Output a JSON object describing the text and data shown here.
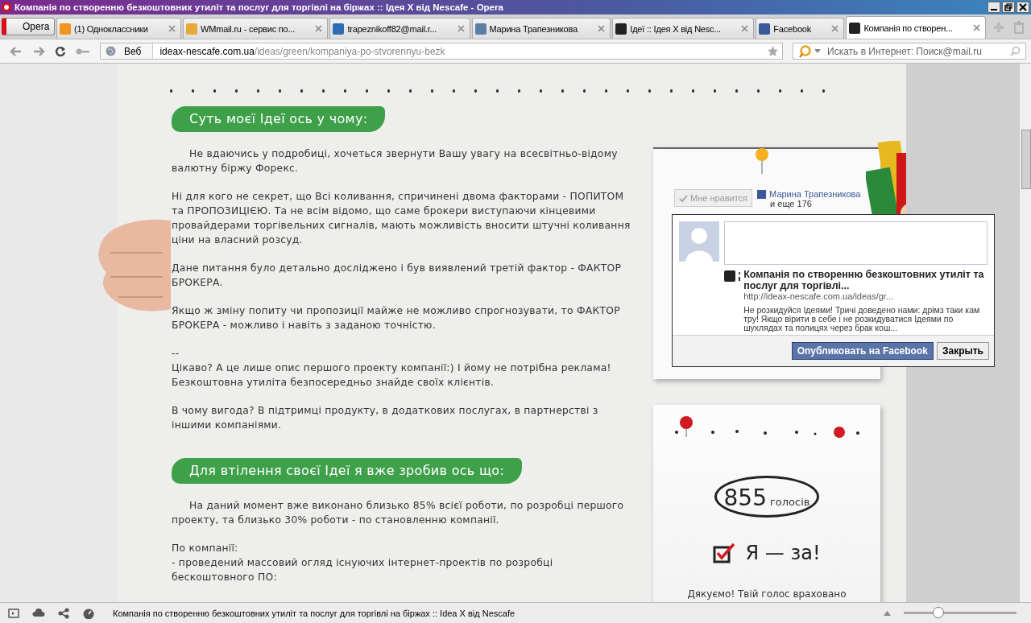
{
  "window": {
    "title": "Компанія по створенню безкоштовних утиліт та послуг для торгівлі на біржах :: Ідея X від Nescafe - Opera"
  },
  "menu_button": {
    "label": "Opera"
  },
  "tabs": [
    {
      "label": "(1) Одноклассники",
      "kind": "ok",
      "selected": false
    },
    {
      "label": "WMmail.ru - сервис по...",
      "kind": "mail",
      "selected": false
    },
    {
      "label": "trapeznikoff82@mail.r...",
      "kind": "at",
      "selected": false
    },
    {
      "label": "Марина Трапезникова",
      "kind": "vk",
      "selected": false
    },
    {
      "label": "Ідеї :: Ідея X від Nesc...",
      "kind": "idea",
      "selected": false
    },
    {
      "label": "Facebook",
      "kind": "facebook",
      "selected": false
    },
    {
      "label": "Компанія по створен...",
      "kind": "idea",
      "selected": true
    }
  ],
  "address_bar": {
    "scope": "Веб",
    "host": "ideax-nescafe.com.ua",
    "path": "/ideas/green/kompaniya-po-stvorennyu-bezk"
  },
  "search": {
    "placeholder": "Искать в Интернет: Поиск@mail.ru"
  },
  "article": [
    {
      "heading": "Суть моєї Ідеї ось у чому:",
      "paragraphs": [
        {
          "text": "Не вдаючись у подробиці, хочеться звернути Вашу увагу на всесвітньо-відому валютну біржу Форекс.",
          "indent": true
        },
        {
          "text": "Ні для кого не секрет, що Всі коливання, спричинені двома факторами - ПОПИТОМ та ПРОПОЗИЦІЄЮ. Та не всім відомо, що саме брокери виступаючи кінцевими провайдерами торгівельних сигналів, мають можливість вносити штучні коливання ціни на власний розсуд.",
          "indent": false
        },
        {
          "text": "Дане питання було детально досліджено і був виявлений третій фактор - ФАКТОР БРОКЕРА.",
          "indent": false
        },
        {
          "text": "Якщо ж зміну попиту чи пропозиції майже не можливо спрогнозувати, то ФАКТОР БРОКЕРА - можливо і навіть з заданою точністю.",
          "indent": false
        },
        {
          "text": "--\nЦікаво? А це лише опис першого проекту компанії:) І йому не потрібна реклама! Безкоштовна утиліта безпосередньо знайде своїх клієнтів.",
          "indent": false
        },
        {
          "text": "В чому вигода? В підтримці продукту, в додаткових послугах, в партнерстві з іншими компаніями.",
          "indent": false
        }
      ]
    },
    {
      "heading": "Для втілення своєї Ідеї я вже зробив ось що:",
      "paragraphs": [
        {
          "text": "На даний момент вже виконано близько 85% всієї роботи, по розробці першого проекту, та близько 30% роботи - по становленню компанії.",
          "indent": true
        },
        {
          "text": "По компанії:\n- проведений массовий огляд існуючих інтернет-проектів по розробці бескоштовного ПО:",
          "indent": false
        }
      ]
    }
  ],
  "like_widget": {
    "button": "Мне нравится",
    "friend": "Марина Трапезникова",
    "others": "и еще 176"
  },
  "share_popup": {
    "title": "Компанія по створенню безкоштовних утиліт та послуг для торгівлі...",
    "url": "http://ideax-nescafe.com.ua/ideas/gr...",
    "description": "Не розкидуйся Ідеями! Тричі доведено нами: дрімз таки кам тру! Якщо вірити в себе і не розкидуватися Ідеями по шухлядах та полицях через брак кош...",
    "publish_button": "Опубликовать на Facebook",
    "close_button": "Закрыть"
  },
  "vote_card": {
    "count": "855",
    "unit": "голосів",
    "vote_label": "Я — за!",
    "voted": true,
    "thanks": "Дякуємо! Твій голос враховано"
  },
  "status_bar": {
    "text": "Компанія по створенню безкоштовних утиліт та послуг для торгівлі на біржах :: Idea X від Nescafe",
    "zoom": {
      "level": 0.3
    }
  }
}
